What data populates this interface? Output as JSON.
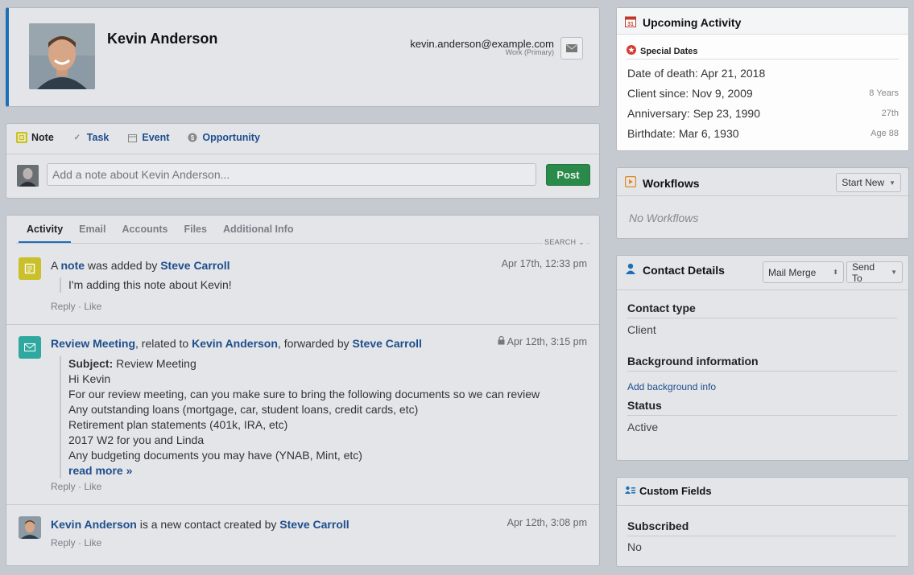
{
  "contact": {
    "name": "Kevin Anderson",
    "email": "kevin.anderson@example.com",
    "email_type": "Work (Primary)"
  },
  "composer": {
    "tabs": [
      {
        "label": "Note",
        "icon": "note-icon"
      },
      {
        "label": "Task",
        "icon": "check-icon"
      },
      {
        "label": "Event",
        "icon": "calendar-icon"
      },
      {
        "label": "Opportunity",
        "icon": "dollar-icon"
      }
    ],
    "placeholder": "Add a note about Kevin Anderson...",
    "post_label": "Post"
  },
  "activity": {
    "tabs": [
      "Activity",
      "Email",
      "Accounts",
      "Files",
      "Additional Info"
    ],
    "search_label": "SEARCH",
    "entries": [
      {
        "head_pre": "A ",
        "head_link1": "note",
        "head_mid": " was added by ",
        "head_link2": "Steve Carroll",
        "time": "Apr 17th, 12:33 pm",
        "body": "I'm adding this note about Kevin!",
        "actions": "Reply · Like"
      },
      {
        "head_link1": "Review Meeting",
        "head_mid1": ", related to ",
        "head_link2": "Kevin Anderson",
        "head_mid2": ", forwarded by ",
        "head_link3": "Steve Carroll",
        "time": "Apr 12th, 3:15 pm",
        "subject_label": "Subject:",
        "subject": " Review Meeting",
        "lines": [
          "Hi Kevin",
          "For our review meeting, can you make sure to bring the following documents so we can review",
          "Any outstanding loans (mortgage, car, student loans, credit cards, etc)",
          "Retirement plan statements (401k, IRA, etc)",
          "2017 W2 for you and Linda",
          "Any budgeting documents you may have (YNAB, Mint, etc)"
        ],
        "read_more": "read more »",
        "actions": "Reply · Like"
      },
      {
        "head_link1": "Kevin Anderson",
        "head_mid": " is a new contact created by ",
        "head_link2": "Steve Carroll",
        "time": "Apr 12th, 3:08 pm",
        "actions": "Reply · Like"
      }
    ]
  },
  "upcoming": {
    "title": "Upcoming Activity",
    "section": "Special Dates",
    "dates": [
      {
        "label": "Date of death: Apr 21, 2018",
        "meta": ""
      },
      {
        "label": "Client since: Nov 9, 2009",
        "meta": "8 Years"
      },
      {
        "label": "Anniversary: Sep 23, 1990",
        "meta": "27th"
      },
      {
        "label": "Birthdate: Mar 6, 1930",
        "meta": "Age 88"
      }
    ]
  },
  "workflows": {
    "title": "Workflows",
    "start_new": "Start New",
    "empty": "No Workflows"
  },
  "contact_details": {
    "title": "Contact Details",
    "mail_merge": "Mail Merge",
    "send_to": "Send To",
    "contact_type_label": "Contact type",
    "contact_type": "Client",
    "background_label": "Background information",
    "background_link": "Add background info",
    "status_label": "Status",
    "status": "Active"
  },
  "custom_fields": {
    "title": "Custom Fields",
    "subscribed_label": "Subscribed",
    "subscribed": "No"
  },
  "colors": {
    "accent": "#1d6fb8",
    "link": "#1e4e8c",
    "post_green": "#2a8a4a",
    "note_yellow": "#c9c02a",
    "email_teal": "#2fa9a0",
    "calendar_red": "#c0392b",
    "workflow_orange": "#e08a1e"
  }
}
